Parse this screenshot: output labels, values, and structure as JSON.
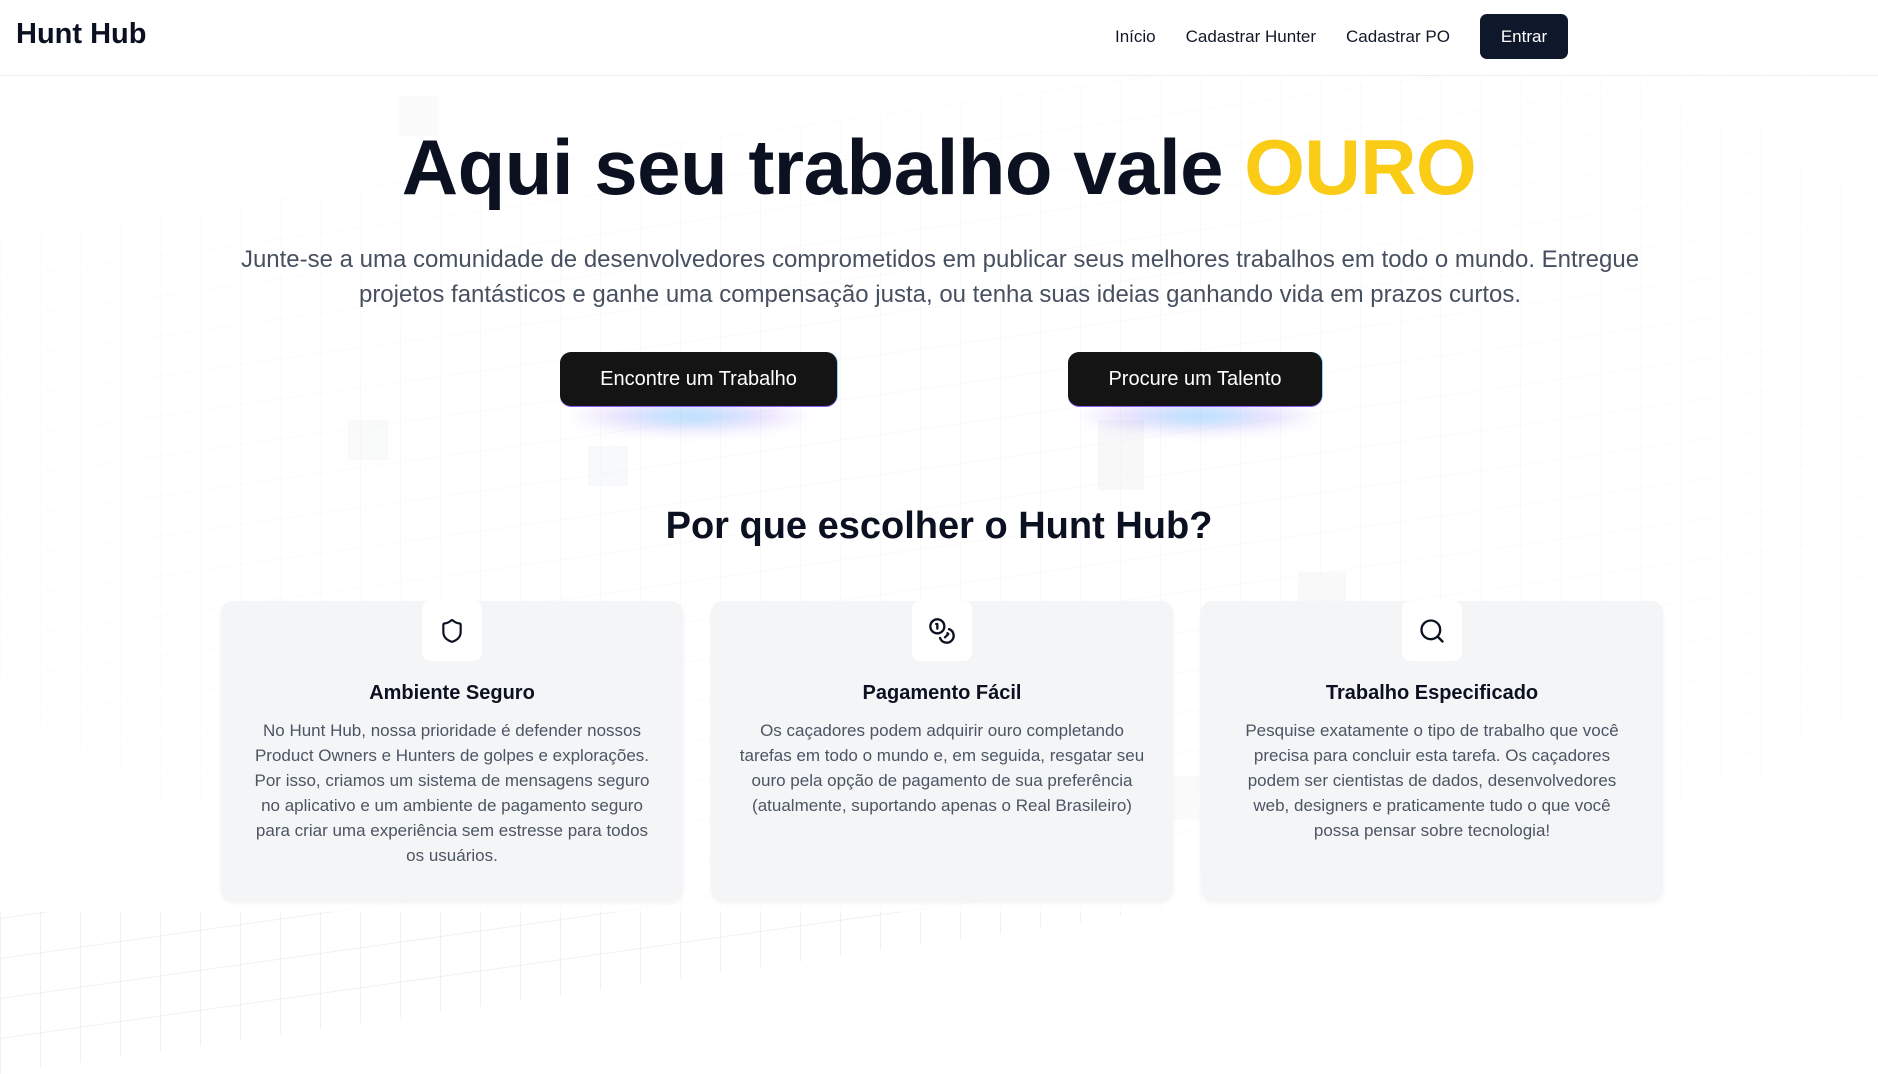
{
  "brand": {
    "name": "Hunt Hub"
  },
  "nav": {
    "links": [
      "Início",
      "Cadastrar Hunter",
      "Cadastrar PO"
    ],
    "login_label": "Entrar"
  },
  "hero": {
    "title_main": "Aqui seu trabalho vale",
    "title_highlight": "OURO",
    "subtitle": "Junte-se a uma comunidade de desenvolvedores comprometidos em publicar seus melhores trabalhos em todo o mundo. Entregue projetos fantásticos e ganhe uma compensação justa, ou tenha suas ideias ganhando vida em prazos curtos.",
    "cta_primary": "Encontre um Trabalho",
    "cta_secondary": "Procure um Talento"
  },
  "features": {
    "title": "Por que escolher o Hunt Hub?",
    "items": [
      {
        "icon": "shield-icon",
        "title": "Ambiente Seguro",
        "text": "No Hunt Hub, nossa prioridade é defender nossos Product Owners e Hunters de golpes e explorações. Por isso, criamos um sistema de mensagens seguro no aplicativo e um ambiente de pagamento seguro para criar uma experiência sem estresse para todos os usuários."
      },
      {
        "icon": "coins-icon",
        "title": "Pagamento Fácil",
        "text": "Os caçadores podem adquirir ouro completando tarefas em todo o mundo e, em seguida, resgatar seu ouro pela opção de pagamento de sua preferência (atualmente, suportando apenas o Real Brasileiro)"
      },
      {
        "icon": "search-icon",
        "title": "Trabalho Especificado",
        "text": "Pesquise exatamente o tipo de trabalho que você precisa para concluir esta tarefa. Os caçadores podem ser cientistas de dados, desenvolvedores web, designers e praticamente tudo o que você possa pensar sobre tecnologia!"
      }
    ]
  },
  "colors": {
    "accent_gold": "#facc15",
    "dark": "#0f172a",
    "cta_bg": "#141414",
    "card_bg": "#f3f4f6"
  }
}
